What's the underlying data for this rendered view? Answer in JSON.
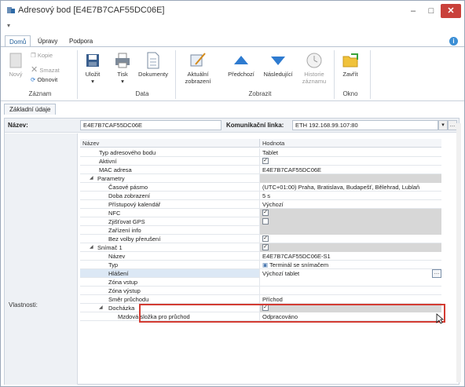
{
  "window": {
    "title": "Adresový bod [E4E7B7CAF55DC06E]",
    "min_label": "–",
    "max_label": "□",
    "close_label": "✕",
    "qat_label": "▾"
  },
  "ribbon_tabs": [
    {
      "label": "Domů"
    },
    {
      "label": "Úpravy"
    },
    {
      "label": "Podpora"
    }
  ],
  "ribbon": {
    "record": {
      "label": "Záznam",
      "new": "Nový",
      "copy": "Kopie",
      "delete": "Smazat",
      "refresh": "Obnovit"
    },
    "data": {
      "label": "Data",
      "save": "Uložit",
      "print": "Tisk",
      "documents": "Dokumenty"
    },
    "view": {
      "label": "Zobrazit",
      "current_view": "Aktuální zobrazení",
      "previous": "Předchozí",
      "next": "Následující",
      "history": "Historie záznamu"
    },
    "window": {
      "label": "Okno",
      "close": "Zavřít"
    }
  },
  "content_tab": "Základní údaje",
  "name_label": "Název:",
  "name_value": "E4E7B7CAF55DC06E",
  "link_label": "Komunikační linka:",
  "link_value": "ETH 192.168.99.107:80",
  "properties_label": "Vlastnosti:",
  "grid": {
    "col_name": "Název",
    "col_value": "Hodnota",
    "rows": [
      {
        "name": "Typ adresového bodu",
        "value": "Tablet"
      },
      {
        "name": "Aktivní",
        "value": "",
        "check": "✓"
      },
      {
        "name": "MAC adresa",
        "value": "E4E7B7CAF55DC06E"
      },
      {
        "name": "Parametry",
        "value": ""
      },
      {
        "name": "Časové pásmo",
        "value": "(UTC+01:00) Praha, Bratislava, Budapešť, Bělehrad, Lublaň"
      },
      {
        "name": "Doba zobrazení",
        "value": "5 s"
      },
      {
        "name": "Přístupový kalendář",
        "value": "Výchozí"
      },
      {
        "name": "NFC",
        "value": "",
        "check": "✓"
      },
      {
        "name": "Zjišťovat GPS",
        "value": "",
        "check": ""
      },
      {
        "name": "Zařízení info",
        "value": ""
      },
      {
        "name": "Bez volby přerušení",
        "value": "",
        "check": "✓"
      },
      {
        "name": "Snímač 1",
        "value": "",
        "check": "✓"
      },
      {
        "name": "Název",
        "value": "E4E7B7CAF55DC06E-S1"
      },
      {
        "name": "Typ",
        "value": "Terminál se snímačem"
      },
      {
        "name": "Hlášení",
        "value": "Výchozí tablet"
      },
      {
        "name": "Zóna vstup",
        "value": ""
      },
      {
        "name": "Zóna výstup",
        "value": ""
      },
      {
        "name": "Směr průchodu",
        "value": "Příchod"
      },
      {
        "name": "Docházka",
        "value": "",
        "check": "✓"
      },
      {
        "name": "Mzdová složka pro průchod",
        "value": "Odpracováno"
      }
    ]
  },
  "colors": {
    "accent": "#1f5d99",
    "close": "#c9413b",
    "highlight": "#d33b32",
    "selection": "#dce8f5"
  }
}
